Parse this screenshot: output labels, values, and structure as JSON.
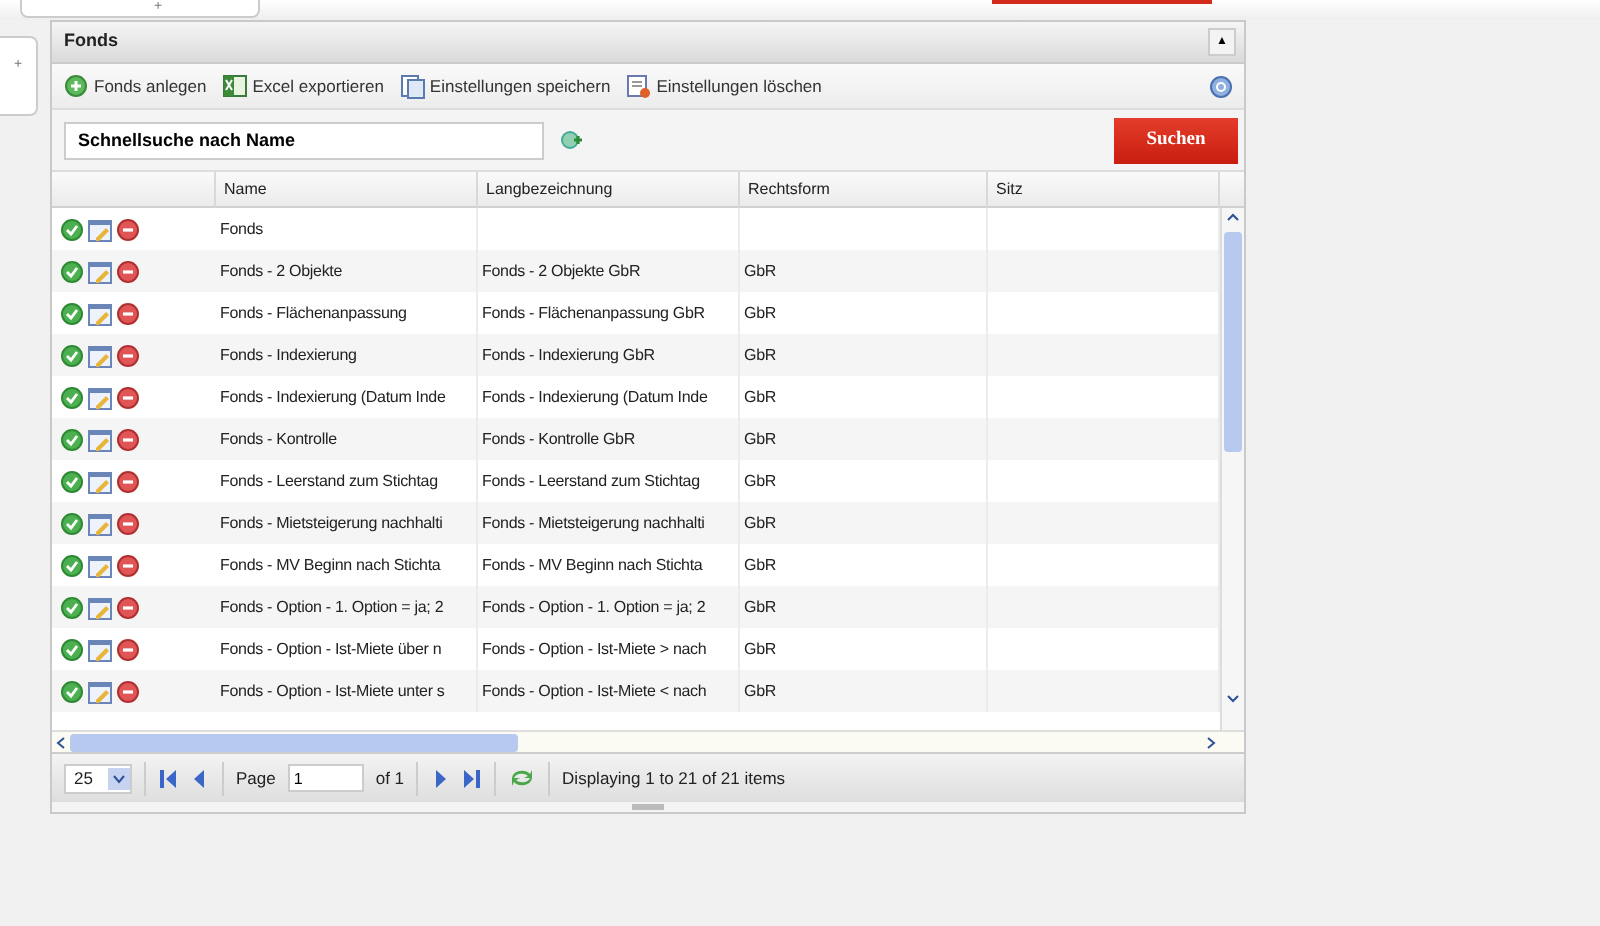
{
  "top_tab": {
    "label": "+"
  },
  "side_tab": {
    "label": "+"
  },
  "panel": {
    "title": "Fonds",
    "collapse": "▲"
  },
  "toolbar": [
    {
      "kind": "add",
      "label": "Fonds anlegen"
    },
    {
      "kind": "excel",
      "label": "Excel exportieren"
    },
    {
      "kind": "save",
      "label": "Einstellungen speichern"
    },
    {
      "kind": "delete",
      "label": "Einstellungen löschen"
    }
  ],
  "search": {
    "value": "Schnellsuche nach Name",
    "button": "Suchen"
  },
  "table": {
    "columns": [
      "Name",
      "Langbezeichnung",
      "Rechtsform",
      "Sitz"
    ],
    "rows": [
      {
        "name": "Fonds"
      },
      {
        "name": "Fonds - 2 Objekte",
        "long": "Fonds - 2 Objekte GbR",
        "form": "GbR"
      },
      {
        "name": "Fonds - Flächenanpassung",
        "long": "Fonds - Flächenanpassung GbR",
        "form": "GbR"
      },
      {
        "name": "Fonds - Indexierung",
        "long": "Fonds - Indexierung GbR",
        "form": "GbR"
      },
      {
        "name": "Fonds - Indexierung (Datum Inde",
        "long": "Fonds - Indexierung (Datum Inde",
        "form": "GbR"
      },
      {
        "name": "Fonds - Kontrolle",
        "long": "Fonds - Kontrolle GbR",
        "form": "GbR"
      },
      {
        "name": "Fonds - Leerstand zum Stichtag",
        "long": "Fonds - Leerstand zum Stichtag",
        "form": "GbR"
      },
      {
        "name": "Fonds - Mietsteigerung nachhalti",
        "long": "Fonds - Mietsteigerung nachhalti",
        "form": "GbR"
      },
      {
        "name": "Fonds - MV Beginn nach Stichta",
        "long": "Fonds - MV Beginn nach Stichta",
        "form": "GbR"
      },
      {
        "name": "Fonds - Option - 1. Option = ja; 2",
        "long": "Fonds - Option - 1. Option = ja; 2",
        "form": "GbR"
      },
      {
        "name": "Fonds - Option - Ist-Miete über n",
        "long": "Fonds - Option - Ist-Miete > nach",
        "form": "GbR"
      },
      {
        "name": "Fonds - Option - Ist-Miete unter s",
        "long": "Fonds - Option - Ist-Miete < nach",
        "form": "GbR"
      }
    ]
  },
  "paging": {
    "page_size": "25",
    "page_label": "Page",
    "page": "1",
    "of": "of 1",
    "info": "Displaying 1 to 21 of 21 items"
  }
}
